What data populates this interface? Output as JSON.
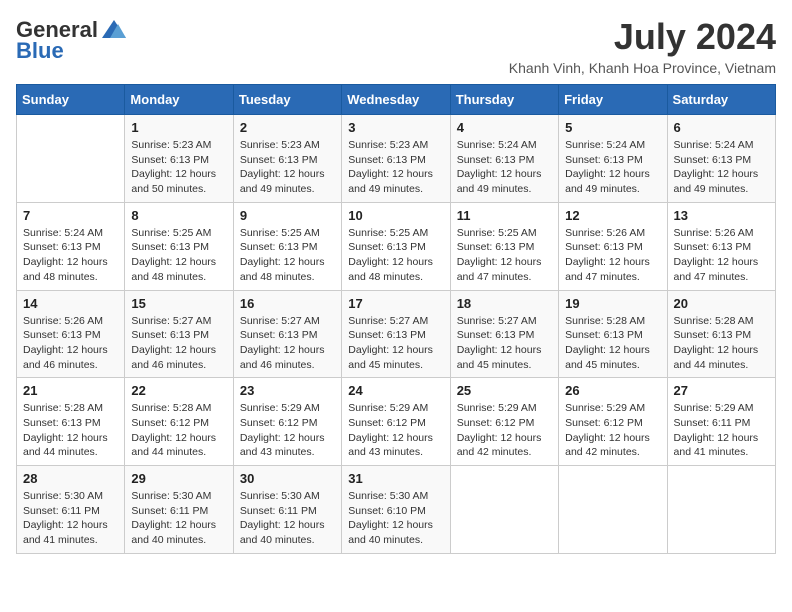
{
  "logo": {
    "general": "General",
    "blue": "Blue"
  },
  "title": "July 2024",
  "subtitle": "Khanh Vinh, Khanh Hoa Province, Vietnam",
  "days_header": [
    "Sunday",
    "Monday",
    "Tuesday",
    "Wednesday",
    "Thursday",
    "Friday",
    "Saturday"
  ],
  "weeks": [
    [
      {
        "day": "",
        "sunrise": "",
        "sunset": "",
        "daylight": ""
      },
      {
        "day": "1",
        "sunrise": "Sunrise: 5:23 AM",
        "sunset": "Sunset: 6:13 PM",
        "daylight": "Daylight: 12 hours and 50 minutes."
      },
      {
        "day": "2",
        "sunrise": "Sunrise: 5:23 AM",
        "sunset": "Sunset: 6:13 PM",
        "daylight": "Daylight: 12 hours and 49 minutes."
      },
      {
        "day": "3",
        "sunrise": "Sunrise: 5:23 AM",
        "sunset": "Sunset: 6:13 PM",
        "daylight": "Daylight: 12 hours and 49 minutes."
      },
      {
        "day": "4",
        "sunrise": "Sunrise: 5:24 AM",
        "sunset": "Sunset: 6:13 PM",
        "daylight": "Daylight: 12 hours and 49 minutes."
      },
      {
        "day": "5",
        "sunrise": "Sunrise: 5:24 AM",
        "sunset": "Sunset: 6:13 PM",
        "daylight": "Daylight: 12 hours and 49 minutes."
      },
      {
        "day": "6",
        "sunrise": "Sunrise: 5:24 AM",
        "sunset": "Sunset: 6:13 PM",
        "daylight": "Daylight: 12 hours and 49 minutes."
      }
    ],
    [
      {
        "day": "7",
        "sunrise": "Sunrise: 5:24 AM",
        "sunset": "Sunset: 6:13 PM",
        "daylight": "Daylight: 12 hours and 48 minutes."
      },
      {
        "day": "8",
        "sunrise": "Sunrise: 5:25 AM",
        "sunset": "Sunset: 6:13 PM",
        "daylight": "Daylight: 12 hours and 48 minutes."
      },
      {
        "day": "9",
        "sunrise": "Sunrise: 5:25 AM",
        "sunset": "Sunset: 6:13 PM",
        "daylight": "Daylight: 12 hours and 48 minutes."
      },
      {
        "day": "10",
        "sunrise": "Sunrise: 5:25 AM",
        "sunset": "Sunset: 6:13 PM",
        "daylight": "Daylight: 12 hours and 48 minutes."
      },
      {
        "day": "11",
        "sunrise": "Sunrise: 5:25 AM",
        "sunset": "Sunset: 6:13 PM",
        "daylight": "Daylight: 12 hours and 47 minutes."
      },
      {
        "day": "12",
        "sunrise": "Sunrise: 5:26 AM",
        "sunset": "Sunset: 6:13 PM",
        "daylight": "Daylight: 12 hours and 47 minutes."
      },
      {
        "day": "13",
        "sunrise": "Sunrise: 5:26 AM",
        "sunset": "Sunset: 6:13 PM",
        "daylight": "Daylight: 12 hours and 47 minutes."
      }
    ],
    [
      {
        "day": "14",
        "sunrise": "Sunrise: 5:26 AM",
        "sunset": "Sunset: 6:13 PM",
        "daylight": "Daylight: 12 hours and 46 minutes."
      },
      {
        "day": "15",
        "sunrise": "Sunrise: 5:27 AM",
        "sunset": "Sunset: 6:13 PM",
        "daylight": "Daylight: 12 hours and 46 minutes."
      },
      {
        "day": "16",
        "sunrise": "Sunrise: 5:27 AM",
        "sunset": "Sunset: 6:13 PM",
        "daylight": "Daylight: 12 hours and 46 minutes."
      },
      {
        "day": "17",
        "sunrise": "Sunrise: 5:27 AM",
        "sunset": "Sunset: 6:13 PM",
        "daylight": "Daylight: 12 hours and 45 minutes."
      },
      {
        "day": "18",
        "sunrise": "Sunrise: 5:27 AM",
        "sunset": "Sunset: 6:13 PM",
        "daylight": "Daylight: 12 hours and 45 minutes."
      },
      {
        "day": "19",
        "sunrise": "Sunrise: 5:28 AM",
        "sunset": "Sunset: 6:13 PM",
        "daylight": "Daylight: 12 hours and 45 minutes."
      },
      {
        "day": "20",
        "sunrise": "Sunrise: 5:28 AM",
        "sunset": "Sunset: 6:13 PM",
        "daylight": "Daylight: 12 hours and 44 minutes."
      }
    ],
    [
      {
        "day": "21",
        "sunrise": "Sunrise: 5:28 AM",
        "sunset": "Sunset: 6:13 PM",
        "daylight": "Daylight: 12 hours and 44 minutes."
      },
      {
        "day": "22",
        "sunrise": "Sunrise: 5:28 AM",
        "sunset": "Sunset: 6:12 PM",
        "daylight": "Daylight: 12 hours and 44 minutes."
      },
      {
        "day": "23",
        "sunrise": "Sunrise: 5:29 AM",
        "sunset": "Sunset: 6:12 PM",
        "daylight": "Daylight: 12 hours and 43 minutes."
      },
      {
        "day": "24",
        "sunrise": "Sunrise: 5:29 AM",
        "sunset": "Sunset: 6:12 PM",
        "daylight": "Daylight: 12 hours and 43 minutes."
      },
      {
        "day": "25",
        "sunrise": "Sunrise: 5:29 AM",
        "sunset": "Sunset: 6:12 PM",
        "daylight": "Daylight: 12 hours and 42 minutes."
      },
      {
        "day": "26",
        "sunrise": "Sunrise: 5:29 AM",
        "sunset": "Sunset: 6:12 PM",
        "daylight": "Daylight: 12 hours and 42 minutes."
      },
      {
        "day": "27",
        "sunrise": "Sunrise: 5:29 AM",
        "sunset": "Sunset: 6:11 PM",
        "daylight": "Daylight: 12 hours and 41 minutes."
      }
    ],
    [
      {
        "day": "28",
        "sunrise": "Sunrise: 5:30 AM",
        "sunset": "Sunset: 6:11 PM",
        "daylight": "Daylight: 12 hours and 41 minutes."
      },
      {
        "day": "29",
        "sunrise": "Sunrise: 5:30 AM",
        "sunset": "Sunset: 6:11 PM",
        "daylight": "Daylight: 12 hours and 40 minutes."
      },
      {
        "day": "30",
        "sunrise": "Sunrise: 5:30 AM",
        "sunset": "Sunset: 6:11 PM",
        "daylight": "Daylight: 12 hours and 40 minutes."
      },
      {
        "day": "31",
        "sunrise": "Sunrise: 5:30 AM",
        "sunset": "Sunset: 6:10 PM",
        "daylight": "Daylight: 12 hours and 40 minutes."
      },
      {
        "day": "",
        "sunrise": "",
        "sunset": "",
        "daylight": ""
      },
      {
        "day": "",
        "sunrise": "",
        "sunset": "",
        "daylight": ""
      },
      {
        "day": "",
        "sunrise": "",
        "sunset": "",
        "daylight": ""
      }
    ]
  ]
}
